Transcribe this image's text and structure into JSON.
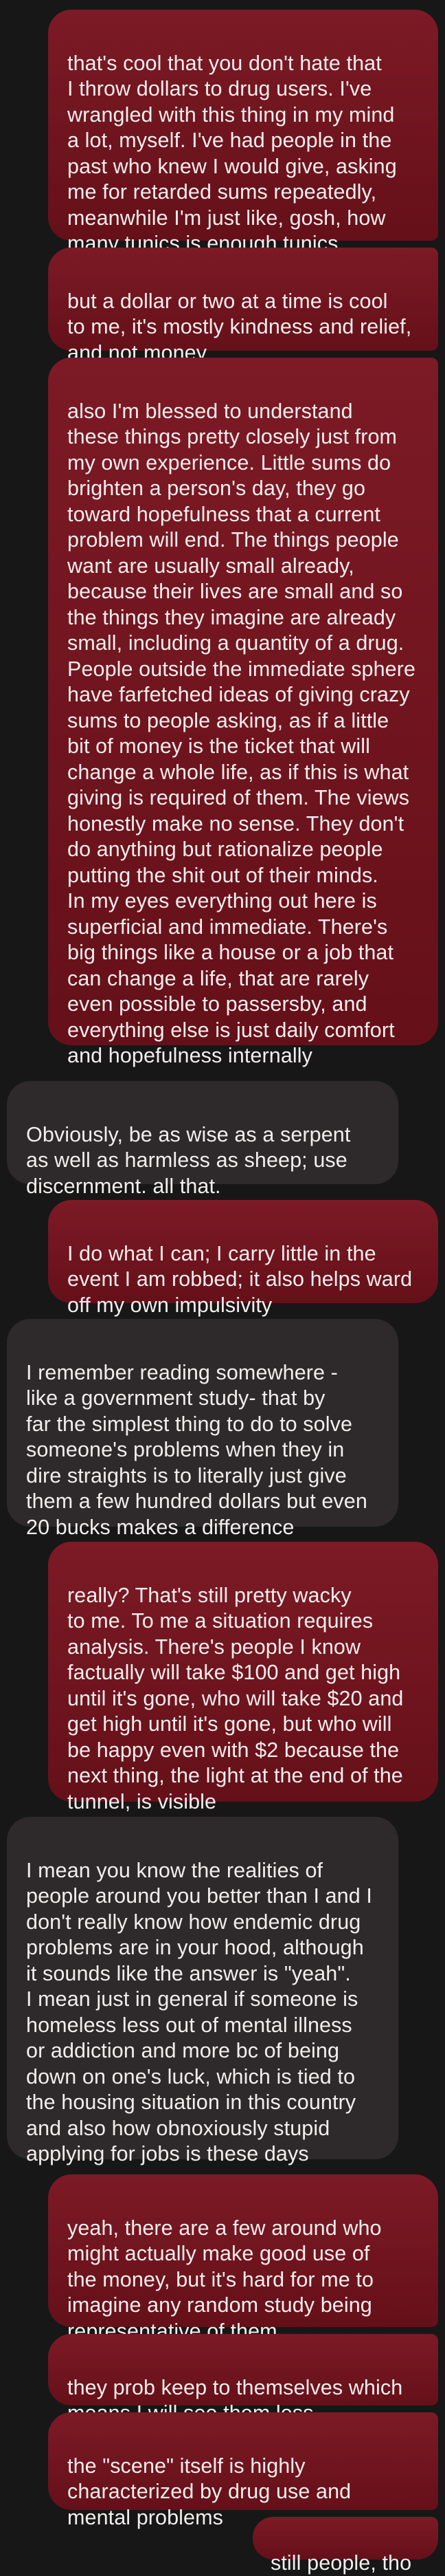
{
  "messages": [
    {
      "from": "me",
      "text": "that's cool that you don't hate that\nI throw dollars to drug users. I've\nwrangled with this thing in my mind\na lot, myself. I've had people in the\npast who knew I would give, asking\nme for retarded sums repeatedly,\nmeanwhile I'm just like, gosh, how\nmany tunics is enough tunics"
    },
    {
      "from": "me",
      "text": "but a dollar or two at a time is cool\nto me, it's mostly kindness and relief,\nand not money"
    },
    {
      "from": "me",
      "text": "also I'm blessed to understand\nthese things pretty closely just from\nmy own experience. Little sums do\nbrighten a person's day, they go\ntoward hopefulness that a current\nproblem will end. The things people\nwant are usually small already,\nbecause their lives are small and so\nthe things they imagine are already\nsmall, including a quantity of a drug.\nPeople outside the immediate sphere\nhave farfetched ideas of giving crazy\nsums to people asking, as if a little\nbit of money is the ticket that will\nchange a whole life, as if this is what\ngiving is required of them. The views\nhonestly make no sense. They don't\ndo anything but rationalize people\nputting the shit out of their minds.\nIn my eyes everything out here is\nsuperficial and immediate. There's\nbig things like a house or a job that\ncan change a life, that are rarely\neven possible to passersby, and\neverything else is just daily comfort\nand hopefulness internally"
    },
    {
      "from": "them",
      "text": "Obviously, be as wise as a serpent\nas well as harmless as sheep; use\ndiscernment. all that."
    },
    {
      "from": "me",
      "text": "I do what I can; I carry little in the\nevent I am robbed; it also helps ward\noff my own impulsivity"
    },
    {
      "from": "them",
      "text": "I remember reading somewhere -\nlike a government study- that by\nfar the simplest thing to do to solve\nsomeone's problems when they in\ndire straights is to literally just give\nthem a few hundred dollars but even\n20 bucks makes a difference"
    },
    {
      "from": "me",
      "text": "really? That's still pretty wacky\nto me. To me a situation requires\nanalysis. There's people I know\nfactually will take $100 and get high\nuntil it's gone, who will take $20 and\nget high until it's gone, but who will\nbe happy even with $2 because the\nnext thing, the light at the end of the\ntunnel, is visible"
    },
    {
      "from": "them",
      "text": "I mean you know the realities of\npeople around you better than I and I\ndon't really know how endemic drug\nproblems are in your hood, although\nit sounds like the answer is \"yeah\".\nI mean just in general if someone is\nhomeless less out of mental illness\nor addiction and more bc of being\ndown on one's luck, which is tied to\nthe housing situation in this country\nand also how obnoxiously stupid\napplying for jobs is these days"
    },
    {
      "from": "me",
      "text": "yeah, there are a few around who\nmight actually make good use of\nthe money, but it's hard for me to\nimagine any random study being\nrepresentative of them"
    },
    {
      "from": "me",
      "text": "they prob keep to themselves which\nmeans I will see them less"
    },
    {
      "from": "me",
      "text": "the \"scene\" itself is highly\ncharacterized by drug use and\nmental problems"
    },
    {
      "from": "me",
      "text": "still people, tho"
    }
  ],
  "colors": {
    "background": "#171717",
    "sent_bubble": "#701520",
    "received_bubble": "#2e2a2b",
    "text": "#f3eeee"
  }
}
